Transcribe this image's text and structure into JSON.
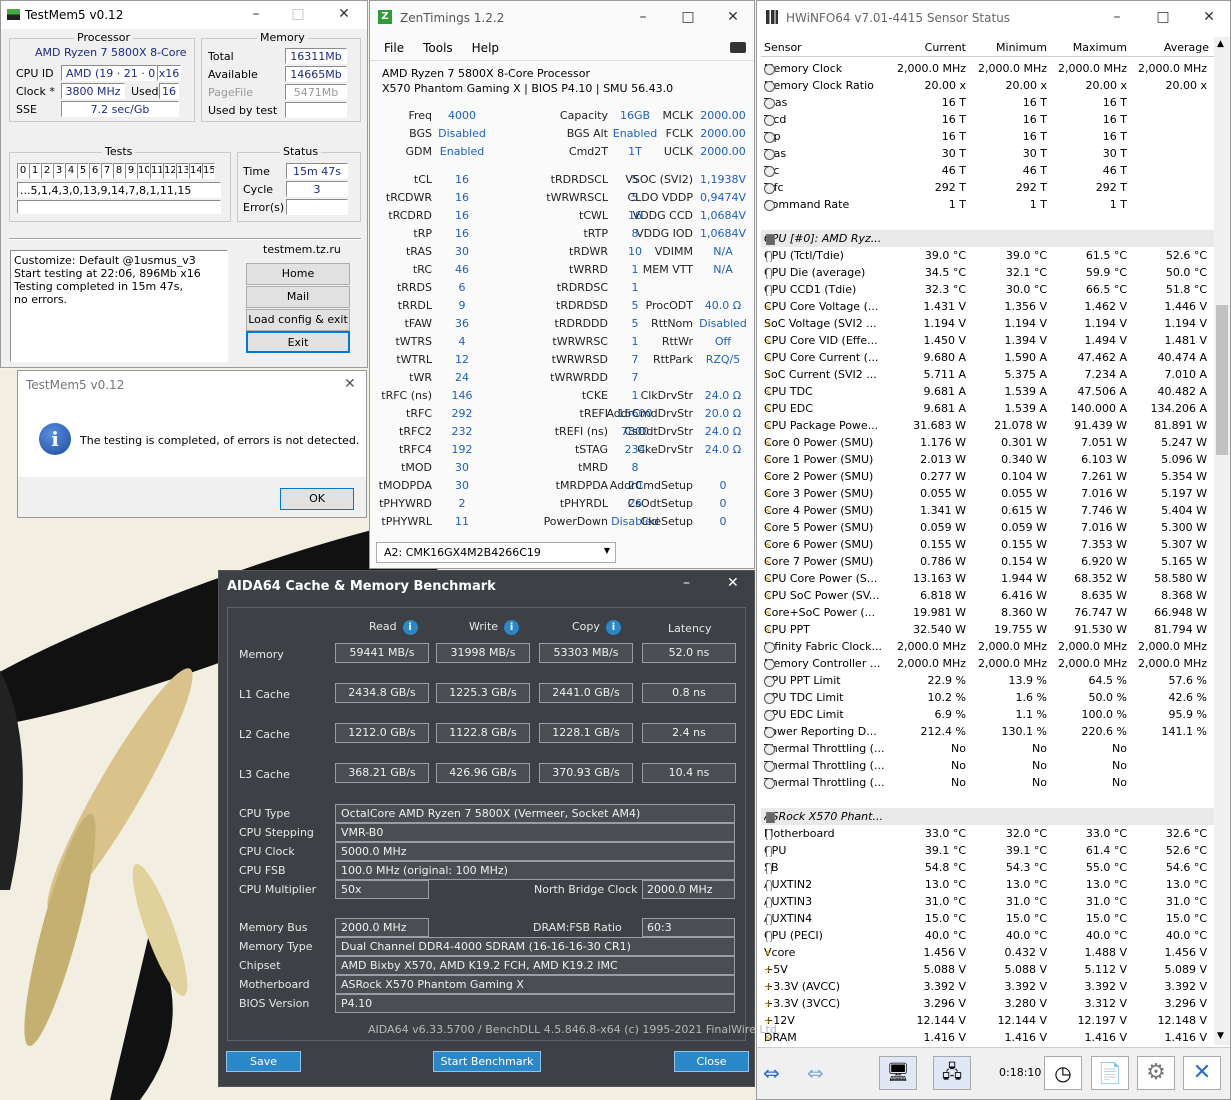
{
  "testmem": {
    "title": "TestMem5 v0.12",
    "processor": {
      "label": "Processor",
      "name": "AMD Ryzen 7 5800X 8-Core",
      "cpu_id_label": "CPU ID",
      "cpu_id_vendor": "AMD",
      "cpu_id_value": "(19 · 21 · 0)",
      "cpu_id_x": "x16",
      "clock_label": "Clock *",
      "clock_value": "3800 MHz",
      "used_label": "Used",
      "used_value": "16",
      "sse_label": "SSE",
      "sse_value": "7.2 sec/Gb"
    },
    "memory": {
      "label": "Memory",
      "total_label": "Total",
      "total_value": "16311Mb",
      "available_label": "Available",
      "available_value": "14665Mb",
      "pagefile_label": "PageFile",
      "pagefile_value": "5471Mb",
      "usedby_label": "Used by test",
      "usedby_value": ""
    },
    "tests": {
      "label": "Tests",
      "cells": [
        "0",
        "1",
        "2",
        "3",
        "4",
        "5",
        "6",
        "7",
        "8",
        "9",
        "10",
        "11",
        "12",
        "13",
        "14",
        "15"
      ],
      "sequence": "...5,1,4,3,0,13,9,14,7,8,1,11,15"
    },
    "status": {
      "label": "Status",
      "time_label": "Time",
      "time_value": "15m 47s",
      "cycle_label": "Cycle",
      "cycle_value": "3",
      "errors_label": "Error(s)",
      "errors_value": ""
    },
    "log": [
      "Customize: Default @1usmus_v3",
      "Start testing at 22:06, 896Mb x16",
      "Testing completed in 15m 47s,",
      "no errors."
    ],
    "site": "testmem.tz.ru",
    "buttons": {
      "home": "Home",
      "mail": "Mail",
      "load": "Load config & exit",
      "exit": "Exit"
    }
  },
  "dialog": {
    "title": "TestMem5 v0.12",
    "message": "The testing is completed, of errors is not detected.",
    "ok": "OK",
    "info_icon": "info-icon"
  },
  "zen": {
    "title": "ZenTimings 1.2.2",
    "menu": [
      "File",
      "Tools",
      "Help"
    ],
    "cpu": "AMD Ryzen 7 5800X 8-Core Processor",
    "board": "X570 Phantom Gaming X | BIOS P4.10 | SMU 56.43.0",
    "col1": [
      [
        "Freq",
        "4000"
      ],
      [
        "BGS",
        "Disabled"
      ],
      [
        "GDM",
        "Enabled"
      ],
      [
        "",
        ""
      ],
      [
        "tCL",
        "16"
      ],
      [
        "tRCDWR",
        "16"
      ],
      [
        "tRCDRD",
        "16"
      ],
      [
        "tRP",
        "16"
      ],
      [
        "tRAS",
        "30"
      ],
      [
        "tRC",
        "46"
      ],
      [
        "tRRDS",
        "6"
      ],
      [
        "tRRDL",
        "9"
      ],
      [
        "tFAW",
        "36"
      ],
      [
        "tWTRS",
        "4"
      ],
      [
        "tWTRL",
        "12"
      ],
      [
        "tWR",
        "24"
      ],
      [
        "tRFC (ns)",
        "146"
      ],
      [
        "tRFC",
        "292"
      ],
      [
        "tRFC2",
        "232"
      ],
      [
        "tRFC4",
        "192"
      ],
      [
        "tMOD",
        "30"
      ],
      [
        "tMODPDA",
        "30"
      ],
      [
        "tPHYWRD",
        "2"
      ],
      [
        "tPHYWRL",
        "11"
      ]
    ],
    "col2": [
      [
        "Capacity",
        "16GB"
      ],
      [
        "BGS Alt",
        "Enabled"
      ],
      [
        "Cmd2T",
        "1T"
      ],
      [
        "",
        ""
      ],
      [
        "tRDRDSCL",
        "5"
      ],
      [
        "tWRWRSCL",
        "5"
      ],
      [
        "tCWL",
        "16"
      ],
      [
        "tRTP",
        "8"
      ],
      [
        "tRDWR",
        "10"
      ],
      [
        "tWRRD",
        "1"
      ],
      [
        "tRDRDSC",
        "1"
      ],
      [
        "tRDRDSD",
        "5"
      ],
      [
        "tRDRDDD",
        "5"
      ],
      [
        "tWRWRSC",
        "1"
      ],
      [
        "tWRWRSD",
        "7"
      ],
      [
        "tWRWRDD",
        "7"
      ],
      [
        "tCKE",
        "1"
      ],
      [
        "tREFI",
        "15600"
      ],
      [
        "tREFI (ns)",
        "7800"
      ],
      [
        "tSTAG",
        "234"
      ],
      [
        "tMRD",
        "8"
      ],
      [
        "tMRDPDA",
        "20"
      ],
      [
        "tPHYRDL",
        "26"
      ],
      [
        "PowerDown",
        "Disabled"
      ]
    ],
    "col3": [
      [
        "MCLK",
        "2000.00"
      ],
      [
        "FCLK",
        "2000.00"
      ],
      [
        "UCLK",
        "2000.00"
      ],
      [
        "",
        ""
      ],
      [
        "VSOC (SVI2)",
        "1,1938V"
      ],
      [
        "CLDO VDDP",
        "0,9474V"
      ],
      [
        "VDDG CCD",
        "1,0684V"
      ],
      [
        "VDDG IOD",
        "1,0684V"
      ],
      [
        "VDIMM",
        "N/A"
      ],
      [
        "MEM VTT",
        "N/A"
      ],
      [
        "",
        ""
      ],
      [
        "ProcODT",
        "40.0 Ω"
      ],
      [
        "RttNom",
        "Disabled"
      ],
      [
        "RttWr",
        "Off"
      ],
      [
        "RttPark",
        "RZQ/5"
      ],
      [
        "",
        ""
      ],
      [
        "ClkDrvStr",
        "24.0 Ω"
      ],
      [
        "AddrCmdDrvStr",
        "20.0 Ω"
      ],
      [
        "CsOdtDrvStr",
        "24.0 Ω"
      ],
      [
        "CkeDrvStr",
        "24.0 Ω"
      ],
      [
        "",
        ""
      ],
      [
        "AddrCmdSetup",
        "0"
      ],
      [
        "CsOdtSetup",
        "0"
      ],
      [
        "CkeSetup",
        "0"
      ]
    ],
    "dimm": "A2: CMK16GX4M2B4266C19"
  },
  "hwinfo": {
    "title": "HWiNFO64 v7.01-4415 Sensor Status",
    "headers": [
      "Sensor",
      "Current",
      "Minimum",
      "Maximum",
      "Average"
    ],
    "rows": [
      [
        "c",
        "Memory Clock",
        "2,000.0 MHz",
        "2,000.0 MHz",
        "2,000.0 MHz",
        "2,000.0 MHz"
      ],
      [
        "c",
        "Memory Clock Ratio",
        "20.00 x",
        "20.00 x",
        "20.00 x",
        "20.00 x"
      ],
      [
        "c",
        "Tcas",
        "16 T",
        "16 T",
        "16 T",
        ""
      ],
      [
        "c",
        "Trcd",
        "16 T",
        "16 T",
        "16 T",
        ""
      ],
      [
        "c",
        "Trp",
        "16 T",
        "16 T",
        "16 T",
        ""
      ],
      [
        "c",
        "Tras",
        "30 T",
        "30 T",
        "30 T",
        ""
      ],
      [
        "c",
        "Trc",
        "46 T",
        "46 T",
        "46 T",
        ""
      ],
      [
        "c",
        "Trfc",
        "292 T",
        "292 T",
        "292 T",
        ""
      ],
      [
        "c",
        "Command Rate",
        "1 T",
        "1 T",
        "1 T",
        ""
      ],
      [
        "s",
        "",
        "",
        "",
        "",
        ""
      ],
      [
        "g",
        "CPU [#0]: AMD Ryz...",
        "",
        "",
        "",
        ""
      ],
      [
        "t",
        "CPU (Tctl/Tdie)",
        "39.0 °C",
        "39.0 °C",
        "61.5 °C",
        "52.6 °C"
      ],
      [
        "t",
        "CPU Die (average)",
        "34.5 °C",
        "32.1 °C",
        "59.9 °C",
        "50.0 °C"
      ],
      [
        "t",
        "CPU CCD1 (Tdie)",
        "32.3 °C",
        "30.0 °C",
        "66.5 °C",
        "51.8 °C"
      ],
      [
        "b",
        "CPU Core Voltage (...",
        "1.431 V",
        "1.356 V",
        "1.462 V",
        "1.446 V"
      ],
      [
        "b",
        "SoC Voltage (SVI2 ...",
        "1.194 V",
        "1.194 V",
        "1.194 V",
        "1.194 V"
      ],
      [
        "b",
        "CPU Core VID (Effe...",
        "1.450 V",
        "1.394 V",
        "1.494 V",
        "1.481 V"
      ],
      [
        "b",
        "CPU Core Current (...",
        "9.680 A",
        "1.590 A",
        "47.462 A",
        "40.474 A"
      ],
      [
        "b",
        "SoC Current (SVI2 ...",
        "5.711 A",
        "5.375 A",
        "7.234 A",
        "7.010 A"
      ],
      [
        "b",
        "CPU TDC",
        "9.681 A",
        "1.539 A",
        "47.506 A",
        "40.482 A"
      ],
      [
        "b",
        "CPU EDC",
        "9.681 A",
        "1.539 A",
        "140.000 A",
        "134.206 A"
      ],
      [
        "b",
        "CPU Package Powe...",
        "31.683 W",
        "21.078 W",
        "91.439 W",
        "81.891 W"
      ],
      [
        "b",
        "Core 0 Power (SMU)",
        "1.176 W",
        "0.301 W",
        "7.051 W",
        "5.247 W"
      ],
      [
        "b",
        "Core 1 Power (SMU)",
        "2.013 W",
        "0.340 W",
        "6.103 W",
        "5.096 W"
      ],
      [
        "b",
        "Core 2 Power (SMU)",
        "0.277 W",
        "0.104 W",
        "7.261 W",
        "5.354 W"
      ],
      [
        "b",
        "Core 3 Power (SMU)",
        "0.055 W",
        "0.055 W",
        "7.016 W",
        "5.197 W"
      ],
      [
        "b",
        "Core 4 Power (SMU)",
        "1.341 W",
        "0.615 W",
        "7.746 W",
        "5.404 W"
      ],
      [
        "b",
        "Core 5 Power (SMU)",
        "0.059 W",
        "0.059 W",
        "7.016 W",
        "5.300 W"
      ],
      [
        "b",
        "Core 6 Power (SMU)",
        "0.155 W",
        "0.155 W",
        "7.353 W",
        "5.307 W"
      ],
      [
        "b",
        "Core 7 Power (SMU)",
        "0.786 W",
        "0.154 W",
        "6.920 W",
        "5.165 W"
      ],
      [
        "b",
        "CPU Core Power (S...",
        "13.163 W",
        "1.944 W",
        "68.352 W",
        "58.580 W"
      ],
      [
        "b",
        "CPU SoC Power (SV...",
        "6.818 W",
        "6.416 W",
        "8.635 W",
        "8.368 W"
      ],
      [
        "b",
        "Core+SoC Power (...",
        "19.981 W",
        "8.360 W",
        "76.747 W",
        "66.948 W"
      ],
      [
        "b",
        "CPU PPT",
        "32.540 W",
        "19.755 W",
        "91.530 W",
        "81.794 W"
      ],
      [
        "c",
        "Infinity Fabric Clock...",
        "2,000.0 MHz",
        "2,000.0 MHz",
        "2,000.0 MHz",
        "2,000.0 MHz"
      ],
      [
        "c",
        "Memory Controller ...",
        "2,000.0 MHz",
        "2,000.0 MHz",
        "2,000.0 MHz",
        "2,000.0 MHz"
      ],
      [
        "c",
        "CPU PPT Limit",
        "22.9 %",
        "13.9 %",
        "64.5 %",
        "57.6 %"
      ],
      [
        "c",
        "CPU TDC Limit",
        "10.2 %",
        "1.6 %",
        "50.0 %",
        "42.6 %"
      ],
      [
        "c",
        "CPU EDC Limit",
        "6.9 %",
        "1.1 %",
        "100.0 %",
        "95.9 %"
      ],
      [
        "c",
        "Power Reporting D...",
        "212.4 %",
        "130.1 %",
        "220.6 %",
        "141.1 %"
      ],
      [
        "c",
        "Thermal Throttling (...",
        "No",
        "No",
        "No",
        ""
      ],
      [
        "c",
        "Thermal Throttling (...",
        "No",
        "No",
        "No",
        ""
      ],
      [
        "c",
        "Thermal Throttling (...",
        "No",
        "No",
        "No",
        ""
      ],
      [
        "s",
        "",
        "",
        "",
        "",
        ""
      ],
      [
        "g",
        "ASRock X570 Phant...",
        "",
        "",
        "",
        ""
      ],
      [
        "t",
        "Motherboard",
        "33.0 °C",
        "32.0 °C",
        "33.0 °C",
        "32.6 °C"
      ],
      [
        "t",
        "CPU",
        "39.1 °C",
        "39.1 °C",
        "61.4 °C",
        "52.6 °C"
      ],
      [
        "t",
        "SB",
        "54.8 °C",
        "54.3 °C",
        "55.0 °C",
        "54.6 °C"
      ],
      [
        "t",
        "AUXTIN2",
        "13.0 °C",
        "13.0 °C",
        "13.0 °C",
        "13.0 °C"
      ],
      [
        "t",
        "AUXTIN3",
        "31.0 °C",
        "31.0 °C",
        "31.0 °C",
        "31.0 °C"
      ],
      [
        "t",
        "AUXTIN4",
        "15.0 °C",
        "15.0 °C",
        "15.0 °C",
        "15.0 °C"
      ],
      [
        "t",
        "CPU (PECI)",
        "40.0 °C",
        "40.0 °C",
        "40.0 °C",
        "40.0 °C"
      ],
      [
        "b",
        "Vcore",
        "1.456 V",
        "0.432 V",
        "1.488 V",
        "1.456 V"
      ],
      [
        "b",
        "+5V",
        "5.088 V",
        "5.088 V",
        "5.112 V",
        "5.089 V"
      ],
      [
        "b",
        "+3.3V (AVCC)",
        "3.392 V",
        "3.392 V",
        "3.392 V",
        "3.392 V"
      ],
      [
        "b",
        "+3.3V (3VCC)",
        "3.296 V",
        "3.280 V",
        "3.312 V",
        "3.296 V"
      ],
      [
        "b",
        "+12V",
        "12.144 V",
        "12.144 V",
        "12.197 V",
        "12.148 V"
      ],
      [
        "b",
        "DRAM",
        "1.416 V",
        "1.416 V",
        "1.416 V",
        "1.416 V"
      ]
    ],
    "timer": "0:18:10"
  },
  "aida": {
    "title": "AIDA64 Cache & Memory Benchmark",
    "cols": [
      "Read",
      "Write",
      "Copy",
      "Latency"
    ],
    "rows": [
      {
        "label": "Memory",
        "read": "59441 MB/s",
        "write": "31998 MB/s",
        "copy": "53303 MB/s",
        "lat": "52.0 ns"
      },
      {
        "label": "L1 Cache",
        "read": "2434.8 GB/s",
        "write": "1225.3 GB/s",
        "copy": "2441.0 GB/s",
        "lat": "0.8 ns"
      },
      {
        "label": "L2 Cache",
        "read": "1212.0 GB/s",
        "write": "1122.8 GB/s",
        "copy": "1228.1 GB/s",
        "lat": "2.4 ns"
      },
      {
        "label": "L3 Cache",
        "read": "368.21 GB/s",
        "write": "426.96 GB/s",
        "copy": "370.93 GB/s",
        "lat": "10.4 ns"
      }
    ],
    "info": {
      "cpu_type_label": "CPU Type",
      "cpu_type": "OctalCore AMD Ryzen 7 5800X (Vermeer, Socket AM4)",
      "stepping_label": "CPU Stepping",
      "stepping": "VMR-B0",
      "clock_label": "CPU Clock",
      "clock": "5000.0 MHz",
      "fsb_label": "CPU FSB",
      "fsb": "100.0 MHz (original: 100 MHz)",
      "mult_label": "CPU Multiplier",
      "mult": "50x",
      "nb_label": "North Bridge Clock",
      "nb": "2000.0 MHz",
      "membus_label": "Memory Bus",
      "membus": "2000.0 MHz",
      "ratio_label": "DRAM:FSB Ratio",
      "ratio": "60:3",
      "memtype_label": "Memory Type",
      "memtype": "Dual Channel DDR4-4000 SDRAM (16-16-16-30 CR1)",
      "chipset_label": "Chipset",
      "chipset": "AMD Bixby X570, AMD K19.2 FCH, AMD K19.2 IMC",
      "mb_label": "Motherboard",
      "mb": "ASRock X570 Phantom Gaming X",
      "bios_label": "BIOS Version",
      "bios": "P4.10"
    },
    "footer": "AIDA64 v6.33.5700 / BenchDLL 4.5.846.8-x64 (c) 1995-2021 FinalWire Ltd.",
    "buttons": {
      "save": "Save",
      "start": "Start Benchmark",
      "close": "Close"
    }
  }
}
